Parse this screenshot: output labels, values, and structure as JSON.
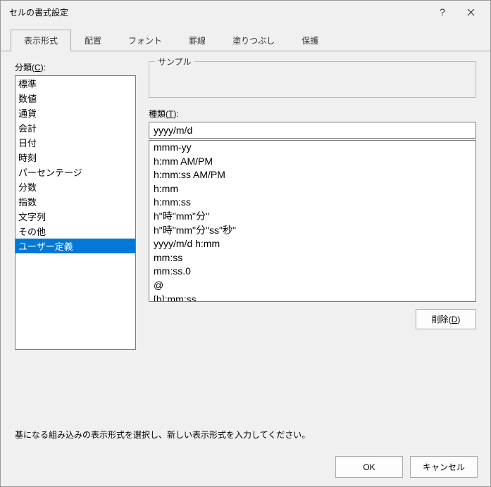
{
  "titlebar": {
    "title": "セルの書式設定"
  },
  "tabs": {
    "items": [
      {
        "label": "表示形式",
        "active": true
      },
      {
        "label": "配置",
        "active": false
      },
      {
        "label": "フォント",
        "active": false
      },
      {
        "label": "罫線",
        "active": false
      },
      {
        "label": "塗りつぶし",
        "active": false
      },
      {
        "label": "保護",
        "active": false
      }
    ]
  },
  "category": {
    "label_prefix": "分類(",
    "label_accel": "C",
    "label_suffix": "):",
    "items": [
      {
        "label": "標準",
        "selected": false
      },
      {
        "label": "数値",
        "selected": false
      },
      {
        "label": "通貨",
        "selected": false
      },
      {
        "label": "会計",
        "selected": false
      },
      {
        "label": "日付",
        "selected": false
      },
      {
        "label": "時刻",
        "selected": false
      },
      {
        "label": "パーセンテージ",
        "selected": false
      },
      {
        "label": "分数",
        "selected": false
      },
      {
        "label": "指数",
        "selected": false
      },
      {
        "label": "文字列",
        "selected": false
      },
      {
        "label": "その他",
        "selected": false
      },
      {
        "label": "ユーザー定義",
        "selected": true
      }
    ]
  },
  "sample": {
    "label": "サンプル",
    "value": ""
  },
  "type": {
    "label_prefix": "種類(",
    "label_accel": "T",
    "label_suffix": "):",
    "value": "yyyy/m/d",
    "items": [
      "mmm-yy",
      "h:mm AM/PM",
      "h:mm:ss AM/PM",
      "h:mm",
      "h:mm:ss",
      "h\"時\"mm\"分\"",
      "h\"時\"mm\"分\"ss\"秒\"",
      "yyyy/m/d h:mm",
      "mm:ss",
      "mm:ss.0",
      "@",
      "[h]:mm:ss"
    ]
  },
  "buttons": {
    "delete_prefix": "削除(",
    "delete_accel": "D",
    "delete_suffix": ")",
    "ok": "OK",
    "cancel": "キャンセル"
  },
  "hint": "基になる組み込みの表示形式を選択し、新しい表示形式を入力してください。"
}
